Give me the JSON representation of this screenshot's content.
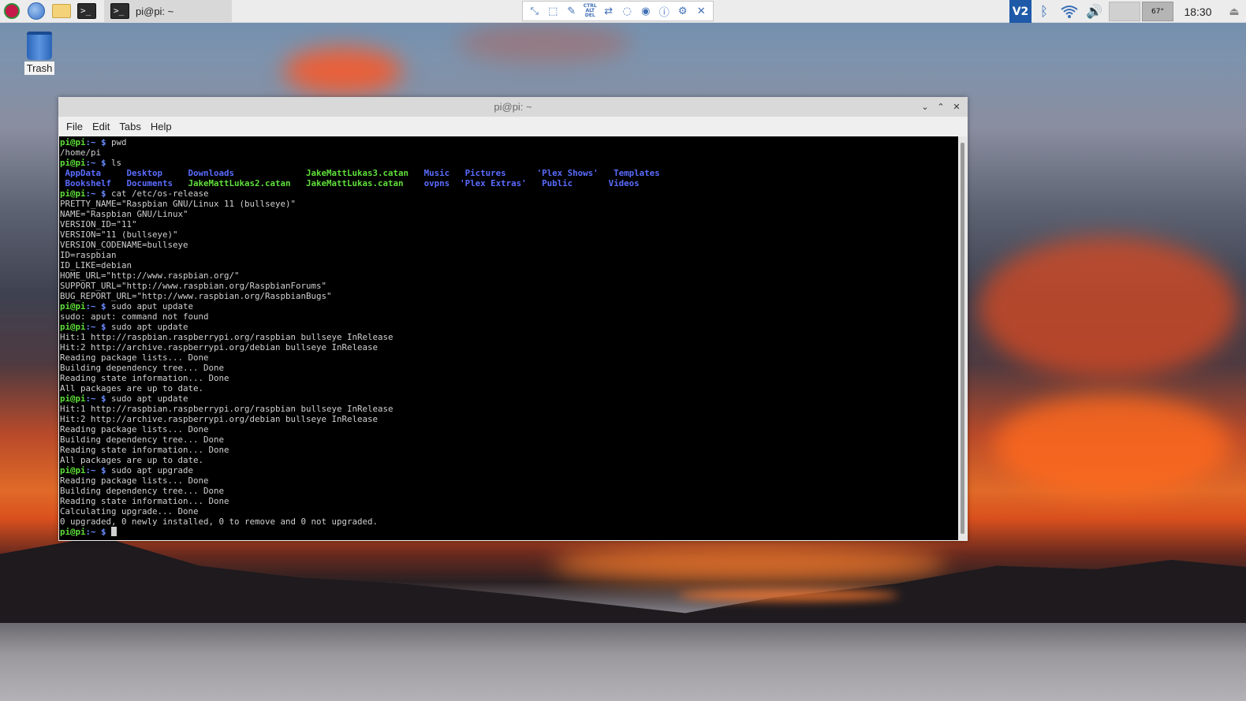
{
  "panel": {
    "task_label": "pi@pi: ~",
    "term_glyph": ">_",
    "clock": "18:30",
    "temperature": "67°",
    "vnc_badge": "V2"
  },
  "vnc_toolbar": {
    "ctrl_alt_del_label": "CTRL ALT DEL"
  },
  "desktop": {
    "trash_label": "Trash"
  },
  "window": {
    "title": "pi@pi: ~",
    "menus": [
      "File",
      "Edit",
      "Tabs",
      "Help"
    ]
  },
  "terminal": {
    "prompt_user": "pi@pi",
    "prompt_path": ":~ $ ",
    "commands": {
      "pwd": "pwd",
      "ls": "ls",
      "cat": "cat /etc/os-release",
      "aput": "sudo aput update",
      "apt1": "sudo apt update",
      "apt2": "sudo apt update",
      "upgrade": "sudo apt upgrade"
    },
    "pwd_output": "/home/pi",
    "ls_row1": [
      {
        "text": " AppData",
        "kind": "dir"
      },
      {
        "text": "     Desktop",
        "kind": "dir"
      },
      {
        "text": "     Downloads",
        "kind": "dir"
      },
      {
        "text": "              JakeMattLukas3.catan",
        "kind": "exe"
      },
      {
        "text": "   Music",
        "kind": "dir"
      },
      {
        "text": "   Pictures",
        "kind": "dir"
      },
      {
        "text": "      'Plex Shows'",
        "kind": "dir"
      },
      {
        "text": "   Templates",
        "kind": "dir"
      }
    ],
    "ls_row2": [
      {
        "text": " Bookshelf",
        "kind": "dir"
      },
      {
        "text": "   Documents",
        "kind": "dir"
      },
      {
        "text": "   JakeMattLukas2.catan",
        "kind": "exe"
      },
      {
        "text": "   JakeMattLukas.catan",
        "kind": "exe"
      },
      {
        "text": "    ovpns",
        "kind": "dir"
      },
      {
        "text": "  'Plex Extras'",
        "kind": "dir"
      },
      {
        "text": "   Public",
        "kind": "dir"
      },
      {
        "text": "       Videos",
        "kind": "dir"
      }
    ],
    "os_release": [
      "PRETTY_NAME=\"Raspbian GNU/Linux 11 (bullseye)\"",
      "NAME=\"Raspbian GNU/Linux\"",
      "VERSION_ID=\"11\"",
      "VERSION=\"11 (bullseye)\"",
      "VERSION_CODENAME=bullseye",
      "ID=raspbian",
      "ID_LIKE=debian",
      "HOME_URL=\"http://www.raspbian.org/\"",
      "SUPPORT_URL=\"http://www.raspbian.org/RaspbianForums\"",
      "BUG_REPORT_URL=\"http://www.raspbian.org/RaspbianBugs\""
    ],
    "aput_output": "sudo: aput: command not found",
    "apt_output": [
      "Hit:1 http://raspbian.raspberrypi.org/raspbian bullseye InRelease",
      "Hit:2 http://archive.raspberrypi.org/debian bullseye InRelease",
      "Reading package lists... Done",
      "Building dependency tree... Done",
      "Reading state information... Done",
      "All packages are up to date."
    ],
    "upgrade_output": [
      "Reading package lists... Done",
      "Building dependency tree... Done",
      "Reading state information... Done",
      "Calculating upgrade... Done",
      "0 upgraded, 0 newly installed, 0 to remove and 0 not upgraded."
    ]
  },
  "colors": {
    "prompt_green": "#5fdf3a",
    "dir_blue": "#5a6cff",
    "terminal_bg": "#000000",
    "panel_bg": "#ececec"
  }
}
